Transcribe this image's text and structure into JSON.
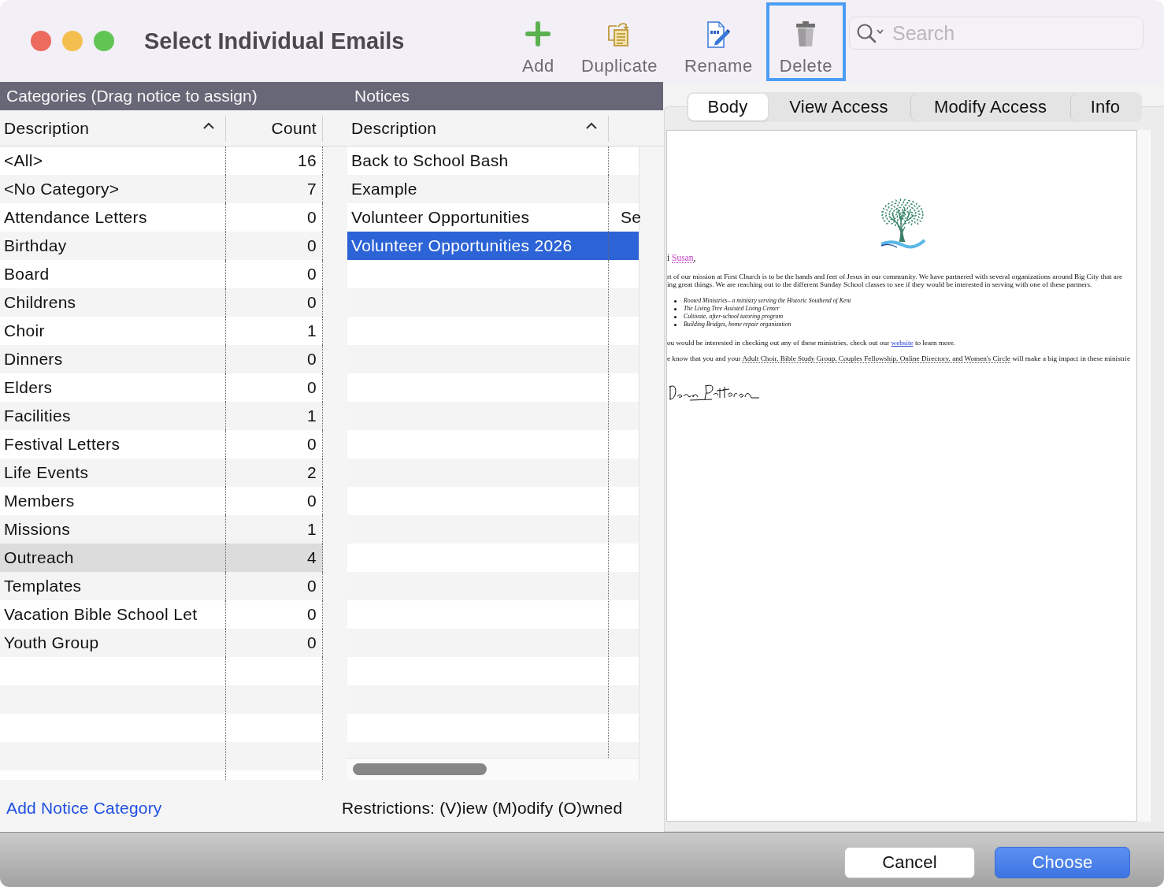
{
  "window": {
    "title": "Select Individual Emails"
  },
  "toolbar": [
    {
      "label": "Add",
      "kind": "add",
      "focused": false
    },
    {
      "label": "Duplicate",
      "kind": "duplicate",
      "focused": false
    },
    {
      "label": "Rename",
      "kind": "rename",
      "focused": false
    },
    {
      "label": "Delete",
      "kind": "delete",
      "focused": true
    }
  ],
  "search": {
    "placeholder": "Search"
  },
  "categories": {
    "title": "Categories (Drag notice to assign)",
    "columns": [
      {
        "label": "Description",
        "sort_ascending": true
      },
      {
        "label": "Count",
        "sort_ascending": false
      }
    ],
    "rows": [
      {
        "name": "<All>",
        "count": "16",
        "selected": false
      },
      {
        "name": "<No Category>",
        "count": "7",
        "selected": false
      },
      {
        "name": "Attendance Letters",
        "count": "0",
        "selected": false
      },
      {
        "name": "Birthday",
        "count": "0",
        "selected": false
      },
      {
        "name": "Board",
        "count": "0",
        "selected": false
      },
      {
        "name": "Childrens",
        "count": "0",
        "selected": false
      },
      {
        "name": "Choir",
        "count": "1",
        "selected": false
      },
      {
        "name": "Dinners",
        "count": "0",
        "selected": false
      },
      {
        "name": "Elders",
        "count": "0",
        "selected": false
      },
      {
        "name": "Facilities",
        "count": "1",
        "selected": false
      },
      {
        "name": "Festival Letters",
        "count": "0",
        "selected": false
      },
      {
        "name": "Life Events",
        "count": "2",
        "selected": false
      },
      {
        "name": "Members",
        "count": "0",
        "selected": false
      },
      {
        "name": "Missions",
        "count": "1",
        "selected": false
      },
      {
        "name": "Outreach",
        "count": "4",
        "selected": true
      },
      {
        "name": "Templates",
        "count": "0",
        "selected": false
      },
      {
        "name": "Vacation Bible School Let",
        "count": "0",
        "selected": false
      },
      {
        "name": "Youth Group",
        "count": "0",
        "selected": false
      }
    ]
  },
  "notices": {
    "title": "Notices",
    "columns": [
      {
        "label": "Description",
        "sort_ascending": true
      }
    ],
    "rows": [
      {
        "description": "Back to School Bash",
        "selected": false
      },
      {
        "description": "Example",
        "selected": false
      },
      {
        "description": "Volunteer Opportunities",
        "column_2": "Se",
        "selected": false
      },
      {
        "description": "Volunteer Opportunities 2026",
        "selected": true
      }
    ]
  },
  "add_category_link": "Add Notice Category",
  "restrictions": "Restrictions: (V)iew (M)odify (O)wned",
  "preview_tabs": [
    {
      "label": "Body",
      "selected": true
    },
    {
      "label": "View Access",
      "selected": false
    },
    {
      "label": "Modify Access",
      "selected": false
    },
    {
      "label": "Info",
      "selected": false
    }
  ],
  "preview": {
    "greeting": [
      {
        "text": "i ",
        "kind": "text"
      },
      {
        "text": "Susan",
        "kind": "name"
      },
      {
        "text": ",",
        "kind": "text"
      }
    ],
    "intro": [
      "rt of our mission at First Church is to be the hands and feet of Jesus in our community. We have partnered with several organizations around Big City that are",
      "ing great things. We are reaching out to the different Sunday School classes to see if they would be interested in serving with one of these partners."
    ],
    "bullets": [
      "Rooted Ministries– a ministry serving the Historic Southend of Kent",
      "The Living Tree Assisted Living Center",
      "Cultivate, after-school tutoring program",
      "Building Bridges, home repair organization"
    ],
    "link_paragraph": [
      {
        "text": "ou would be interested in checking out any of these ministries, check out our ",
        "kind": "text"
      },
      {
        "text": "website",
        "kind": "link"
      },
      {
        "text": " to learn more.",
        "kind": "text"
      }
    ],
    "closing": [
      {
        "text": "e know that you and your ",
        "kind": "text"
      },
      {
        "text": "Adult Choir, Bible Study Group, Couples Fellowship, Online Directory, and Women's Circle",
        "kind": "field"
      },
      {
        "text": " will make a big impact in these ministrie",
        "kind": "text"
      }
    ]
  },
  "buttons": [
    {
      "label": "Cancel",
      "kind": "secondary"
    },
    {
      "label": "Choose",
      "kind": "primary"
    }
  ]
}
